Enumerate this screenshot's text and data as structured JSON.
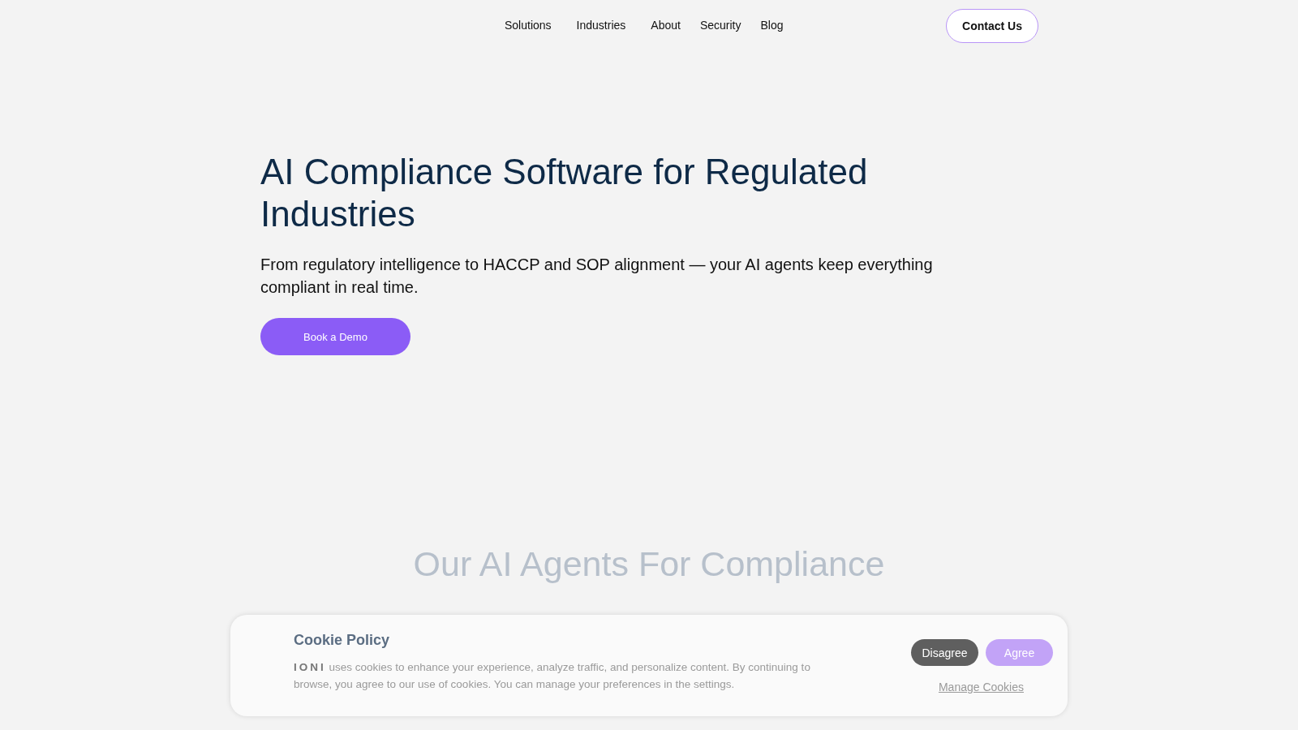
{
  "nav": {
    "items": [
      {
        "label": "Solutions"
      },
      {
        "label": "Industries"
      },
      {
        "label": "About"
      },
      {
        "label": "Security"
      },
      {
        "label": "Blog"
      }
    ],
    "contact_button": "Contact Us"
  },
  "hero": {
    "title": "AI Compliance Software for Regulated Industries",
    "subtitle": "From regulatory intelligence to HACCP and SOP alignment — your AI agents keep everything compliant in real time.",
    "cta": "Book a Demo"
  },
  "agents_section": {
    "title": "Our AI Agents For Compliance"
  },
  "cookie_banner": {
    "title": "Cookie Policy",
    "text": "**IONI** uses cookies to enhance your experience, analyze traffic, and personalize content. By continuing to browse, you agree to our use of cookies. You can manage your preferences in the settings.",
    "buttons": [
      "Disagree",
      "Agree"
    ],
    "manage_link": "Manage Cookies"
  }
}
